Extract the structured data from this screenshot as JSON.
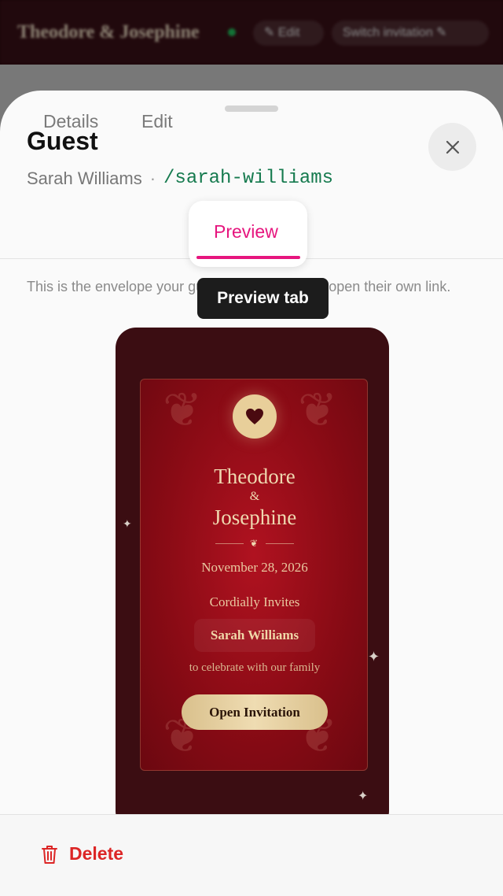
{
  "background": {
    "title": "Theodore & Josephine",
    "edit_label": "✎ Edit",
    "switch_label": "Switch invitation ✎"
  },
  "sheet": {
    "title": "Guest",
    "guest_name": "Sarah Williams",
    "separator": "·",
    "slug": "/sarah-williams",
    "tabs": [
      {
        "label": "Details"
      },
      {
        "label": "Edit"
      },
      {
        "label": "Preview",
        "active": true
      }
    ],
    "description": "This is the envelope your guest sees when they open their own link.",
    "tooltip": "Preview tab"
  },
  "preview": {
    "name1": "Theodore",
    "ampersand": "&",
    "name2": "Josephine",
    "date": "November 28, 2026",
    "invites": "Cordially Invites",
    "guest": "Sarah Williams",
    "celebrate": "to celebrate with our family",
    "button": "Open Invitation"
  },
  "footer": {
    "delete_label": "Delete"
  },
  "colors": {
    "accent": "#e6157e",
    "slug": "#157a4e",
    "danger": "#dc2626",
    "card": "#8a0b15",
    "gold": "#e8cf9a"
  }
}
